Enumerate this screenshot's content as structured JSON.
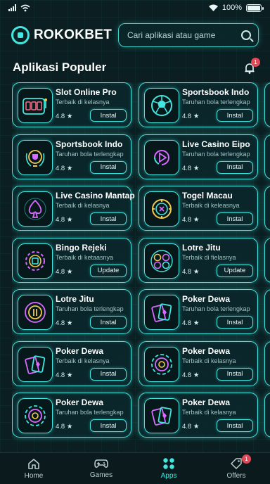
{
  "status_bar": {
    "battery": "100%",
    "battery_level": 1.0
  },
  "header": {
    "brand": "ROKOKBET",
    "search_placeholder": "Cari aplikasi atau game"
  },
  "section": {
    "title": "Aplikasi Populer",
    "notification_count": "1"
  },
  "apps": [
    {
      "title": "Slot Online Pro",
      "subtitle": "Terbaik di kelasnya",
      "rating": "4.8 ★",
      "button": "Instal",
      "icon": "slot-machine-icon"
    },
    {
      "title": "Sportsbook Indo",
      "subtitle": "Taruhan bola terlengkap",
      "rating": "4.8 ★",
      "button": "Instal",
      "icon": "soccer-ball-icon"
    },
    {
      "title": "Sportsbook Indo",
      "subtitle": "Taruhan bola terlengkap",
      "rating": "4.8 ★",
      "button": "Instal",
      "icon": "trophy-icon"
    },
    {
      "title": "Live Casino Eipo",
      "subtitle": "Taruhan bola terlengkap",
      "rating": "4.8 ★",
      "button": "Instal",
      "icon": "play-icon"
    },
    {
      "title": "Live Casino Mantap",
      "subtitle": "Terbaik di kelasnya",
      "rating": "4.8 ★",
      "button": "Instal",
      "icon": "spade-icon"
    },
    {
      "title": "Togel Macau",
      "subtitle": "Terbaik di keleasnya",
      "rating": "4.8 ★",
      "button": "Instal",
      "icon": "chip-icon"
    },
    {
      "title": "Bingo Rejeki",
      "subtitle": "Terbaik di ketaasnya",
      "rating": "4.8 ★",
      "button": "Update",
      "icon": "bingo-chip-icon"
    },
    {
      "title": "Lotre Jitu",
      "subtitle": "Terbaik di fielasnya",
      "rating": "4.8 ★",
      "button": "Update",
      "icon": "lottery-balls-icon"
    },
    {
      "title": "Lotre Jitu",
      "subtitle": "Taruhan bola terlengkap",
      "rating": "4.8 ★",
      "button": "Instal",
      "icon": "lottery-chip-icon"
    },
    {
      "title": "Poker Dewa",
      "subtitle": "Taruhan bola terlengkap",
      "rating": "4.8 ★",
      "button": "Instal",
      "icon": "playing-cards-icon"
    },
    {
      "title": "Poker Dewa",
      "subtitle": "Terbaik di kelasnya",
      "rating": "4.8 ★",
      "button": "Instal",
      "icon": "playing-cards-icon"
    },
    {
      "title": "Poker Dewa",
      "subtitle": "Terbaik di kelasnya",
      "rating": "4.8 ★",
      "button": "Instal",
      "icon": "poker-chip-icon"
    },
    {
      "title": "Poker Dewa",
      "subtitle": "Taruhan bola terlengkap",
      "rating": "4.8 ★",
      "button": "Instal",
      "icon": "poker-chip-icon"
    },
    {
      "title": "Poker Dewa",
      "subtitle": "Terbaik di kelasnya",
      "rating": "4.8 ★",
      "button": "Instal",
      "icon": "playing-cards-icon"
    }
  ],
  "bottom_nav": [
    {
      "label": "Home",
      "icon": "home-icon"
    },
    {
      "label": "Games",
      "icon": "gamepad-icon"
    },
    {
      "label": "Apps",
      "icon": "apps-grid-icon",
      "active": true
    },
    {
      "label": "Offers",
      "icon": "tag-icon",
      "badge": "1"
    }
  ],
  "colors": {
    "accent": "#43e6df",
    "background": "#0b1f22",
    "badge": "#e04a58"
  }
}
